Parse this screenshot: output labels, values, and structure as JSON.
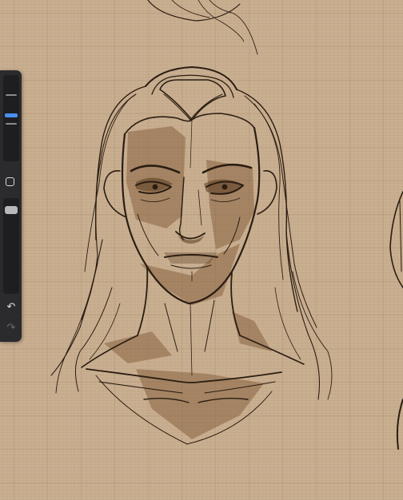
{
  "app": {
    "name": ""
  },
  "canvas": {
    "paper_color": "#c8ad8e",
    "ink_color": "#2a1d12",
    "wash_color": "#8a5f38"
  },
  "sidebar": {
    "brush_size": {
      "level": 0.48,
      "accent": "#4a8ff0"
    },
    "modify_button": {
      "icon": "square-outline-icon"
    },
    "brush_opacity": {
      "level": 0.95
    },
    "undo": {
      "glyph": "↶",
      "icon": "undo-icon"
    },
    "redo": {
      "glyph": "↷",
      "icon": "redo-icon"
    }
  }
}
